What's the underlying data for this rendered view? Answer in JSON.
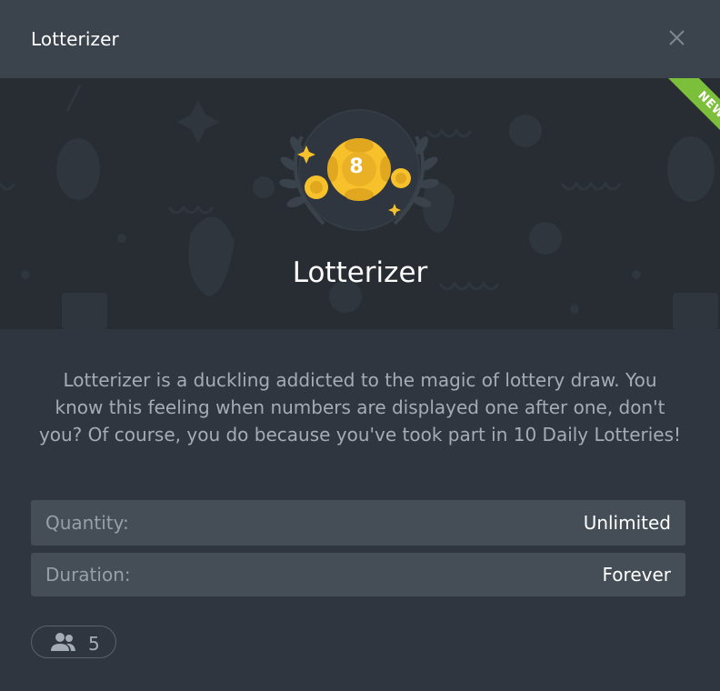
{
  "header": {
    "title": "Lotterizer",
    "close_icon": "close-icon"
  },
  "hero": {
    "ribbon_label": "NEW",
    "ribbon_color": "#7bbf3a",
    "badge_icon": "lottery-ball-laurel-icon",
    "ball_number": "8",
    "title": "Lotterizer"
  },
  "description": "Lotterizer is a duckling addicted to the magic of lottery draw. You know this feeling when numbers are displayed one after one, don't you? Of course, you do because you've took part in 10 Daily Lotteries!",
  "details": [
    {
      "label": "Quantity:",
      "value": "Unlimited"
    },
    {
      "label": "Duration:",
      "value": "Forever"
    }
  ],
  "members": {
    "icon": "users-icon",
    "count": "5"
  },
  "colors": {
    "header_bg": "#3b434c",
    "hero_bg": "#272d33",
    "body_bg": "#2f363f",
    "row_bg": "#454e57",
    "gold": "#f7c12c"
  }
}
